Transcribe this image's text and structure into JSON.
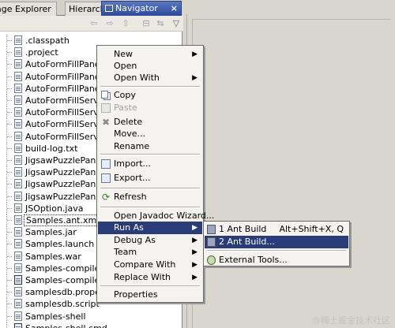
{
  "tabs": [
    {
      "label": "age Explorer"
    },
    {
      "label": "Hierarchy"
    },
    {
      "label": "Navigator",
      "active": true,
      "close": "×"
    }
  ],
  "toolbar": {
    "back": "⇦",
    "forward": "⇨",
    "up": "⇧",
    "collapse": "⊟",
    "link": "⇆",
    "menu": "▽"
  },
  "tree": {
    "items": [
      {
        "label": ".classpath",
        "icon": "file-icon"
      },
      {
        "label": ".project",
        "icon": "file-icon"
      },
      {
        "label": "AutoFormFillPanelTest-",
        "icon": "file-icon"
      },
      {
        "label": "AutoFormFillPanelTest-",
        "icon": "file-icon"
      },
      {
        "label": "AutoFormFillPanelTest-",
        "icon": "file-icon"
      },
      {
        "label": "AutoFormFillServiceTes",
        "icon": "file-icon"
      },
      {
        "label": "AutoFormFillServiceTes",
        "icon": "file-icon"
      },
      {
        "label": "AutoFormFillServiceTes",
        "icon": "file-icon"
      },
      {
        "label": "AutoFormFillServiceTes",
        "icon": "file-icon"
      },
      {
        "label": "build-log.txt",
        "icon": "file-icon"
      },
      {
        "label": "JigsawPuzzlePanelTest",
        "icon": "file-icon"
      },
      {
        "label": "JigsawPuzzlePanelTest",
        "icon": "file-icon"
      },
      {
        "label": "JigsawPuzzlePanelTest",
        "icon": "file-icon"
      },
      {
        "label": "JigsawPuzzlePanelTest",
        "icon": "file-icon"
      },
      {
        "label": "JSOption.java",
        "icon": "java-file-icon"
      },
      {
        "label": "Samples.ant.xml",
        "icon": "file-icon",
        "selected": true
      },
      {
        "label": "Samples.jar",
        "icon": "file-icon"
      },
      {
        "label": "Samples.launch",
        "icon": "file-icon"
      },
      {
        "label": "Samples.war",
        "icon": "file-icon"
      },
      {
        "label": "Samples-compile",
        "icon": "file-icon"
      },
      {
        "label": "Samples-compile.cmd",
        "icon": "cmd-file-icon"
      },
      {
        "label": "samplesdb.properties",
        "icon": "file-icon"
      },
      {
        "label": "samplesdb.script",
        "icon": "file-icon"
      },
      {
        "label": "Samples-shell",
        "icon": "file-icon"
      },
      {
        "label": "Samples-shell.cmd",
        "icon": "cmd-file-icon"
      }
    ]
  },
  "context_menu": {
    "items": [
      {
        "label": "New",
        "arrow": "▶"
      },
      {
        "label": "Open"
      },
      {
        "label": "Open With",
        "arrow": "▶"
      },
      {
        "label": "Copy",
        "icon": "copy-icon"
      },
      {
        "label": "Paste",
        "icon": "paste-icon",
        "disabled": true
      },
      {
        "label": "Delete",
        "icon": "delete-icon",
        "glyph": "✖"
      },
      {
        "label": "Move..."
      },
      {
        "label": "Rename"
      },
      {
        "label": "Import...",
        "icon": "import-icon"
      },
      {
        "label": "Export...",
        "icon": "export-icon"
      },
      {
        "label": "Refresh",
        "icon": "refresh-icon",
        "glyph": "⟳"
      },
      {
        "label": "Open Javadoc Wizard..."
      },
      {
        "label": "Run As",
        "arrow": "▶",
        "highlighted": true
      },
      {
        "label": "Debug As",
        "arrow": "▶"
      },
      {
        "label": "Team",
        "arrow": "▶"
      },
      {
        "label": "Compare With",
        "arrow": "▶"
      },
      {
        "label": "Replace With",
        "arrow": "▶"
      },
      {
        "label": "Properties"
      }
    ]
  },
  "submenu": {
    "items": [
      {
        "label": "1 Ant Build",
        "shortcut": "Alt+Shift+X, Q",
        "icon": "ant-icon"
      },
      {
        "label": "2 Ant Build...",
        "icon": "ant-icon",
        "highlighted": true
      },
      {
        "label": "External Tools...",
        "icon": "external-tools-icon"
      }
    ]
  },
  "watermark": "@稀土掘金技术社区",
  "colors": {
    "selection": "#2a3c7a",
    "active_tab": "#2c4a9a",
    "menu_bg": "#f4f3ef"
  }
}
